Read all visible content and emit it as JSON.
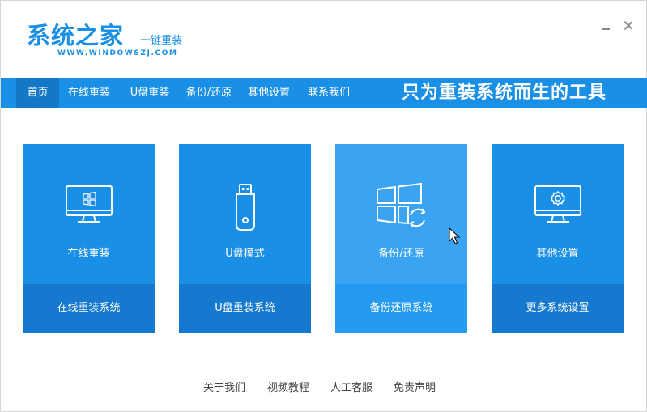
{
  "header": {
    "logo_text": "系统之家",
    "logo_sub": "一键重装",
    "logo_url": "WWW.WINDOWSZJ.COM"
  },
  "nav": {
    "items": [
      {
        "label": "首页",
        "active": true
      },
      {
        "label": "在线重装"
      },
      {
        "label": "U盘重装"
      },
      {
        "label": "备份/还原"
      },
      {
        "label": "其他设置"
      },
      {
        "label": "联系我们"
      }
    ],
    "slogan": "只为重装系统而生的工具"
  },
  "cards": [
    {
      "label": "在线重装",
      "action": "在线重装系统",
      "icon": "monitor-windows-icon"
    },
    {
      "label": "U盘模式",
      "action": "U盘重装系统",
      "icon": "usb-drive-icon"
    },
    {
      "label": "备份/还原",
      "action": "备份还原系统",
      "icon": "windows-refresh-icon",
      "hover": true
    },
    {
      "label": "其他设置",
      "action": "更多系统设置",
      "icon": "monitor-gear-icon"
    }
  ],
  "footer": {
    "links": [
      "关于我们",
      "视频教程",
      "人工客服",
      "免责声明"
    ]
  },
  "colors": {
    "brand": "#1a8fe6",
    "nav_active": "#1478c8",
    "card_bottom": "#1679d0",
    "card_hover": "#3aa4f2"
  }
}
